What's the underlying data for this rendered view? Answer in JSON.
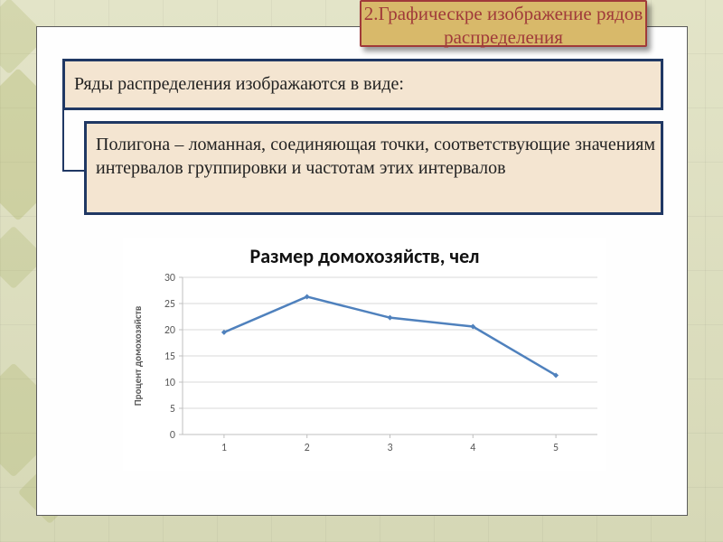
{
  "banner": {
    "text": "2.Графическре изображение рядов распределения"
  },
  "box1": {
    "text": "Ряды распределения изображаются в виде:"
  },
  "box2": {
    "text": "Полигона – ломанная, соединяющая точки, соответствующие значениям интервалов группировки и частотам этих интервалов"
  },
  "chart_data": {
    "type": "line",
    "title": "Размер домохозяйств, чел",
    "xlabel": "",
    "ylabel": "Процент домохозяйств",
    "categories": [
      "1",
      "2",
      "3",
      "4",
      "5"
    ],
    "values": [
      19.5,
      26.3,
      22.3,
      20.6,
      11.3
    ],
    "ylim": [
      0,
      30
    ],
    "yticks": [
      0,
      5,
      10,
      15,
      20,
      25,
      30
    ],
    "grid": true
  }
}
